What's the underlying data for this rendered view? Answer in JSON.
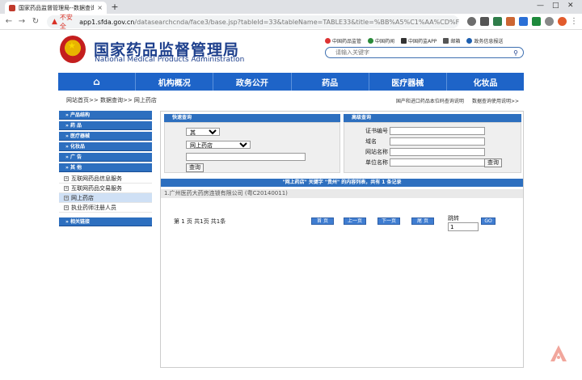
{
  "browser": {
    "tab_title": "国家药品监督管理局--数据查询",
    "tab_close": "×",
    "new_tab": "+",
    "insecure_label": "不安全",
    "url_host": "app1.sfda.gov.cn",
    "url_path": "/datasearchcnda/face3/base.jsp?tableId=33&tableName=TABLE33&title=%BB%A5%C1%AA%CD%F8%D2%A9%C..."
  },
  "site": {
    "name_cn": "国家药品监督管理局",
    "name_en": "National Medical Products Administration",
    "toplinks": [
      "中国药品监管",
      "中国药闻",
      "中国药监APP",
      "邮箱",
      "政务信息报送"
    ],
    "search_placeholder": "请输入关键字"
  },
  "nav": {
    "items": [
      "机构概况",
      "政务公开",
      "药品",
      "医疗器械",
      "化妆品"
    ]
  },
  "breadcrumb": "网站首页>> 数据查询>> 网上药店",
  "crumb_links": [
    "国产和进口药品本位码查询说明",
    "数据查询使用说明>>"
  ],
  "sidebar": {
    "heads": [
      "» 产品结构",
      "» 药 品",
      "» 医疗器械",
      "» 化妆品",
      "» 广 告",
      "» 其 他"
    ],
    "subitems": [
      "互联网药品信息服务",
      "互联网药品交易服务",
      "网上药店",
      "执业药师注册人员"
    ],
    "last_head": "» 相关链接"
  },
  "quick_search": {
    "title": "快速查询",
    "category_selected": "其　　他",
    "table_selected": "网上药店",
    "keyword": "",
    "button": "查询"
  },
  "advanced_search": {
    "title": "高级查询",
    "fields": [
      "证书编号",
      "域名",
      "网站名称",
      "单位名称"
    ],
    "button": "查询"
  },
  "results": {
    "summary": "\"网上药店\" 关键字 \"贵州\" 的内容列表，共有 1 条记录",
    "first_row": "1.广州医药大药房连锁有限公司 (粤C20140011)",
    "pager": "第 1 页 共1页 共1条",
    "buttons": [
      "首 页",
      "上一页",
      "下一页",
      "尾 页"
    ],
    "jump_label": "跳转",
    "jump_value": "1",
    "go": "GO"
  }
}
